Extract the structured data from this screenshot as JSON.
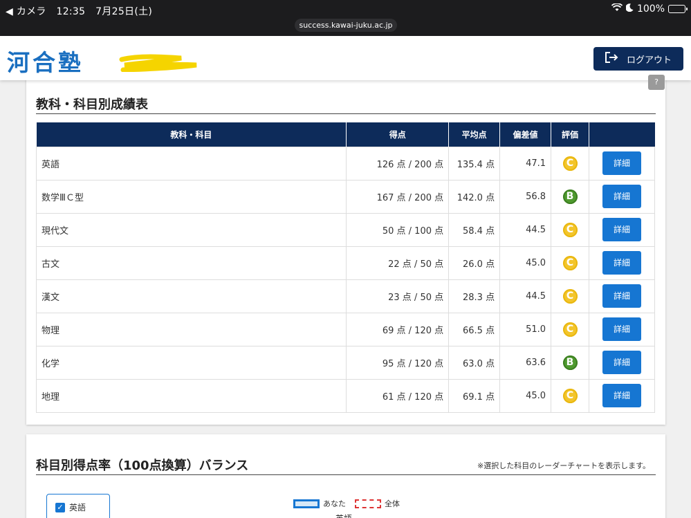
{
  "status": {
    "back_label": "◀ カメラ",
    "time": "12:35",
    "date": "7月25日(土)",
    "battery": "100%",
    "url": "success.kawai-juku.ac.jp"
  },
  "header": {
    "logo": "河合塾",
    "logout_label": "ログアウト"
  },
  "help_label": "?",
  "scores": {
    "title": "教科・科目別成績表",
    "columns": [
      "教科・科目",
      "得点",
      "平均点",
      "偏差値",
      "評価",
      ""
    ],
    "detail_label": "詳細",
    "rows": [
      {
        "subject": "英語",
        "score": "126 点 / 200 点",
        "average": "135.4 点",
        "deviation": "47.1",
        "grade": "C"
      },
      {
        "subject": "数学ⅢＣ型",
        "score": "167 点 / 200 点",
        "average": "142.0 点",
        "deviation": "56.8",
        "grade": "B"
      },
      {
        "subject": "現代文",
        "score": "50 点 / 100 点",
        "average": "58.4 点",
        "deviation": "44.5",
        "grade": "C"
      },
      {
        "subject": "古文",
        "score": "22 点 / 50 点",
        "average": "26.0 点",
        "deviation": "45.0",
        "grade": "C"
      },
      {
        "subject": "漢文",
        "score": "23 点 / 50 点",
        "average": "28.3 点",
        "deviation": "44.5",
        "grade": "C"
      },
      {
        "subject": "物理",
        "score": "69 点 / 120 点",
        "average": "66.5 点",
        "deviation": "51.0",
        "grade": "C"
      },
      {
        "subject": "化学",
        "score": "95 点 / 120 点",
        "average": "63.0 点",
        "deviation": "63.6",
        "grade": "B"
      },
      {
        "subject": "地理",
        "score": "61 点 / 120 点",
        "average": "69.1 点",
        "deviation": "45.0",
        "grade": "C"
      }
    ]
  },
  "balance": {
    "title": "科目別得点率（100点換算）バランス",
    "note": "※選択した科目のレーダーチャートを表示します。",
    "checkbox_label": "英語",
    "legend_you": "あなた",
    "legend_all": "全体",
    "radar_label": "英語"
  },
  "colors": {
    "header_navy": "#0d2b5a",
    "accent_blue": "#1676d2",
    "grade_c": "#f3c52b",
    "grade_b": "#4f9a2f"
  }
}
